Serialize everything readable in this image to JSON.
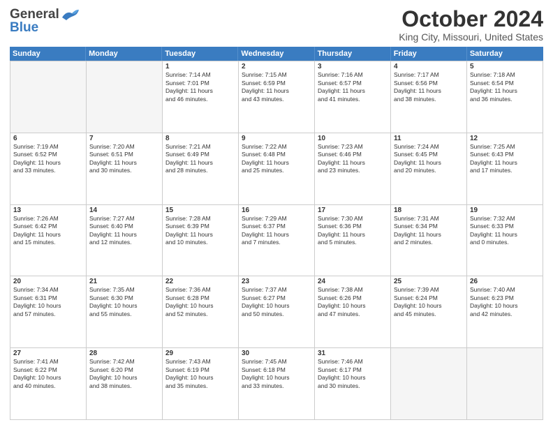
{
  "logo": {
    "line1": "General",
    "line2": "Blue"
  },
  "title": "October 2024",
  "location": "King City, Missouri, United States",
  "days": [
    "Sunday",
    "Monday",
    "Tuesday",
    "Wednesday",
    "Thursday",
    "Friday",
    "Saturday"
  ],
  "weeks": [
    [
      {
        "day": "",
        "empty": true
      },
      {
        "day": "",
        "empty": true
      },
      {
        "day": "1",
        "line1": "Sunrise: 7:14 AM",
        "line2": "Sunset: 7:01 PM",
        "line3": "Daylight: 11 hours",
        "line4": "and 46 minutes."
      },
      {
        "day": "2",
        "line1": "Sunrise: 7:15 AM",
        "line2": "Sunset: 6:59 PM",
        "line3": "Daylight: 11 hours",
        "line4": "and 43 minutes."
      },
      {
        "day": "3",
        "line1": "Sunrise: 7:16 AM",
        "line2": "Sunset: 6:57 PM",
        "line3": "Daylight: 11 hours",
        "line4": "and 41 minutes."
      },
      {
        "day": "4",
        "line1": "Sunrise: 7:17 AM",
        "line2": "Sunset: 6:56 PM",
        "line3": "Daylight: 11 hours",
        "line4": "and 38 minutes."
      },
      {
        "day": "5",
        "line1": "Sunrise: 7:18 AM",
        "line2": "Sunset: 6:54 PM",
        "line3": "Daylight: 11 hours",
        "line4": "and 36 minutes."
      }
    ],
    [
      {
        "day": "6",
        "line1": "Sunrise: 7:19 AM",
        "line2": "Sunset: 6:52 PM",
        "line3": "Daylight: 11 hours",
        "line4": "and 33 minutes."
      },
      {
        "day": "7",
        "line1": "Sunrise: 7:20 AM",
        "line2": "Sunset: 6:51 PM",
        "line3": "Daylight: 11 hours",
        "line4": "and 30 minutes."
      },
      {
        "day": "8",
        "line1": "Sunrise: 7:21 AM",
        "line2": "Sunset: 6:49 PM",
        "line3": "Daylight: 11 hours",
        "line4": "and 28 minutes."
      },
      {
        "day": "9",
        "line1": "Sunrise: 7:22 AM",
        "line2": "Sunset: 6:48 PM",
        "line3": "Daylight: 11 hours",
        "line4": "and 25 minutes."
      },
      {
        "day": "10",
        "line1": "Sunrise: 7:23 AM",
        "line2": "Sunset: 6:46 PM",
        "line3": "Daylight: 11 hours",
        "line4": "and 23 minutes."
      },
      {
        "day": "11",
        "line1": "Sunrise: 7:24 AM",
        "line2": "Sunset: 6:45 PM",
        "line3": "Daylight: 11 hours",
        "line4": "and 20 minutes."
      },
      {
        "day": "12",
        "line1": "Sunrise: 7:25 AM",
        "line2": "Sunset: 6:43 PM",
        "line3": "Daylight: 11 hours",
        "line4": "and 17 minutes."
      }
    ],
    [
      {
        "day": "13",
        "line1": "Sunrise: 7:26 AM",
        "line2": "Sunset: 6:42 PM",
        "line3": "Daylight: 11 hours",
        "line4": "and 15 minutes."
      },
      {
        "day": "14",
        "line1": "Sunrise: 7:27 AM",
        "line2": "Sunset: 6:40 PM",
        "line3": "Daylight: 11 hours",
        "line4": "and 12 minutes."
      },
      {
        "day": "15",
        "line1": "Sunrise: 7:28 AM",
        "line2": "Sunset: 6:39 PM",
        "line3": "Daylight: 11 hours",
        "line4": "and 10 minutes."
      },
      {
        "day": "16",
        "line1": "Sunrise: 7:29 AM",
        "line2": "Sunset: 6:37 PM",
        "line3": "Daylight: 11 hours",
        "line4": "and 7 minutes."
      },
      {
        "day": "17",
        "line1": "Sunrise: 7:30 AM",
        "line2": "Sunset: 6:36 PM",
        "line3": "Daylight: 11 hours",
        "line4": "and 5 minutes."
      },
      {
        "day": "18",
        "line1": "Sunrise: 7:31 AM",
        "line2": "Sunset: 6:34 PM",
        "line3": "Daylight: 11 hours",
        "line4": "and 2 minutes."
      },
      {
        "day": "19",
        "line1": "Sunrise: 7:32 AM",
        "line2": "Sunset: 6:33 PM",
        "line3": "Daylight: 11 hours",
        "line4": "and 0 minutes."
      }
    ],
    [
      {
        "day": "20",
        "line1": "Sunrise: 7:34 AM",
        "line2": "Sunset: 6:31 PM",
        "line3": "Daylight: 10 hours",
        "line4": "and 57 minutes."
      },
      {
        "day": "21",
        "line1": "Sunrise: 7:35 AM",
        "line2": "Sunset: 6:30 PM",
        "line3": "Daylight: 10 hours",
        "line4": "and 55 minutes."
      },
      {
        "day": "22",
        "line1": "Sunrise: 7:36 AM",
        "line2": "Sunset: 6:28 PM",
        "line3": "Daylight: 10 hours",
        "line4": "and 52 minutes."
      },
      {
        "day": "23",
        "line1": "Sunrise: 7:37 AM",
        "line2": "Sunset: 6:27 PM",
        "line3": "Daylight: 10 hours",
        "line4": "and 50 minutes."
      },
      {
        "day": "24",
        "line1": "Sunrise: 7:38 AM",
        "line2": "Sunset: 6:26 PM",
        "line3": "Daylight: 10 hours",
        "line4": "and 47 minutes."
      },
      {
        "day": "25",
        "line1": "Sunrise: 7:39 AM",
        "line2": "Sunset: 6:24 PM",
        "line3": "Daylight: 10 hours",
        "line4": "and 45 minutes."
      },
      {
        "day": "26",
        "line1": "Sunrise: 7:40 AM",
        "line2": "Sunset: 6:23 PM",
        "line3": "Daylight: 10 hours",
        "line4": "and 42 minutes."
      }
    ],
    [
      {
        "day": "27",
        "line1": "Sunrise: 7:41 AM",
        "line2": "Sunset: 6:22 PM",
        "line3": "Daylight: 10 hours",
        "line4": "and 40 minutes."
      },
      {
        "day": "28",
        "line1": "Sunrise: 7:42 AM",
        "line2": "Sunset: 6:20 PM",
        "line3": "Daylight: 10 hours",
        "line4": "and 38 minutes."
      },
      {
        "day": "29",
        "line1": "Sunrise: 7:43 AM",
        "line2": "Sunset: 6:19 PM",
        "line3": "Daylight: 10 hours",
        "line4": "and 35 minutes."
      },
      {
        "day": "30",
        "line1": "Sunrise: 7:45 AM",
        "line2": "Sunset: 6:18 PM",
        "line3": "Daylight: 10 hours",
        "line4": "and 33 minutes."
      },
      {
        "day": "31",
        "line1": "Sunrise: 7:46 AM",
        "line2": "Sunset: 6:17 PM",
        "line3": "Daylight: 10 hours",
        "line4": "and 30 minutes."
      },
      {
        "day": "",
        "empty": true
      },
      {
        "day": "",
        "empty": true
      }
    ]
  ]
}
